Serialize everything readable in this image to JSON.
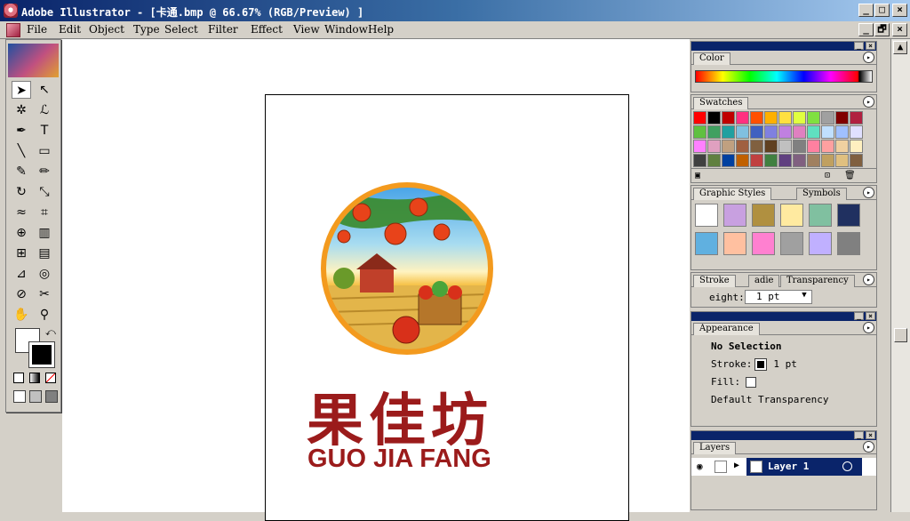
{
  "window": {
    "title": "Adobe Illustrator - [卡通.bmp @ 66.67% (RGB/Preview) ]",
    "controls": [
      "_",
      "□",
      "×"
    ]
  },
  "menubar": {
    "items": [
      "File",
      "Edit",
      "Object",
      "Type",
      "Select",
      "Filter",
      "Effect",
      "View",
      "Window",
      "Help"
    ],
    "doc_controls": [
      "_",
      "🗗",
      "×"
    ]
  },
  "artboard": {
    "logo_chinese": "果佳坊",
    "logo_english": "GUO JIA FANG"
  },
  "colors": {
    "logo_text": "#9b1b1b",
    "ring": "#f39a1e",
    "titlebar_start": "#0a246a",
    "titlebar_end": "#a6caf0"
  },
  "toolbox": {
    "tools": [
      {
        "name": "selection-tool",
        "glyph": "➤"
      },
      {
        "name": "direct-selection-tool",
        "glyph": "↖"
      },
      {
        "name": "magic-wand-tool",
        "glyph": "✲"
      },
      {
        "name": "lasso-tool",
        "glyph": "ℒ"
      },
      {
        "name": "pen-tool",
        "glyph": "✒"
      },
      {
        "name": "type-tool",
        "glyph": "T"
      },
      {
        "name": "line-tool",
        "glyph": "╲"
      },
      {
        "name": "rectangle-tool",
        "glyph": "▭"
      },
      {
        "name": "paintbrush-tool",
        "glyph": "✎"
      },
      {
        "name": "pencil-tool",
        "glyph": "✏"
      },
      {
        "name": "rotate-tool",
        "glyph": "↻"
      },
      {
        "name": "scale-tool",
        "glyph": "⤡"
      },
      {
        "name": "warp-tool",
        "glyph": "≈"
      },
      {
        "name": "free-transform-tool",
        "glyph": "⌗"
      },
      {
        "name": "symbol-sprayer-tool",
        "glyph": "⊕"
      },
      {
        "name": "column-graph-tool",
        "glyph": "▥"
      },
      {
        "name": "mesh-tool",
        "glyph": "⊞"
      },
      {
        "name": "gradient-tool",
        "glyph": "▤"
      },
      {
        "name": "eyedropper-tool",
        "glyph": "⊿"
      },
      {
        "name": "blend-tool",
        "glyph": "◎"
      },
      {
        "name": "slice-tool",
        "glyph": "⊘"
      },
      {
        "name": "scissors-tool",
        "glyph": "✂"
      },
      {
        "name": "hand-tool",
        "glyph": "✋"
      },
      {
        "name": "zoom-tool",
        "glyph": "⚲"
      }
    ]
  },
  "panels": {
    "color": {
      "tab": "Color"
    },
    "swatches": {
      "tab": "Swatches"
    },
    "graphic_styles": {
      "tabs": [
        "Graphic Styles",
        "Symbols"
      ]
    },
    "stroke": {
      "tabs": [
        "Stroke",
        "adie",
        "Transparency"
      ],
      "weight_label": "eight:",
      "weight_value": "1 pt"
    },
    "appearance": {
      "tab": "Appearance",
      "selection": "No Selection",
      "stroke_label": "Stroke:",
      "stroke_value": "1 pt",
      "fill_label": "Fill:",
      "transparency": "Default Transparency"
    },
    "layers": {
      "tab": "Layers",
      "layer_name": "Layer 1"
    }
  },
  "swatch_colors": [
    "#ff0000",
    "#000000",
    "#c00000",
    "#ff3080",
    "#ff5000",
    "#ffb000",
    "#ffe040",
    "#e0ff40",
    "#80e040",
    "#a0a0a0",
    "#800000",
    "#b02040",
    "#60c040",
    "#40a060",
    "#20a0a0",
    "#80c0e0",
    "#4060c0",
    "#8080e0",
    "#c080e0",
    "#e080c0",
    "#60e0c0",
    "#c0e0ff",
    "#a0c0ff",
    "#e0e0ff",
    "#ff80ff",
    "#e0a0c0",
    "#c0a080",
    "#a06040",
    "#806040",
    "#604020",
    "#c0c0c0",
    "#808080",
    "#ff80a0",
    "#ffa0a0",
    "#f0d0a0",
    "#fff0c0",
    "#404040",
    "#608040",
    "#0040a0",
    "#c06000",
    "#c04040",
    "#408040",
    "#604080",
    "#806080",
    "#a08060",
    "#c0a060",
    "#e0c080",
    "#806040"
  ]
}
